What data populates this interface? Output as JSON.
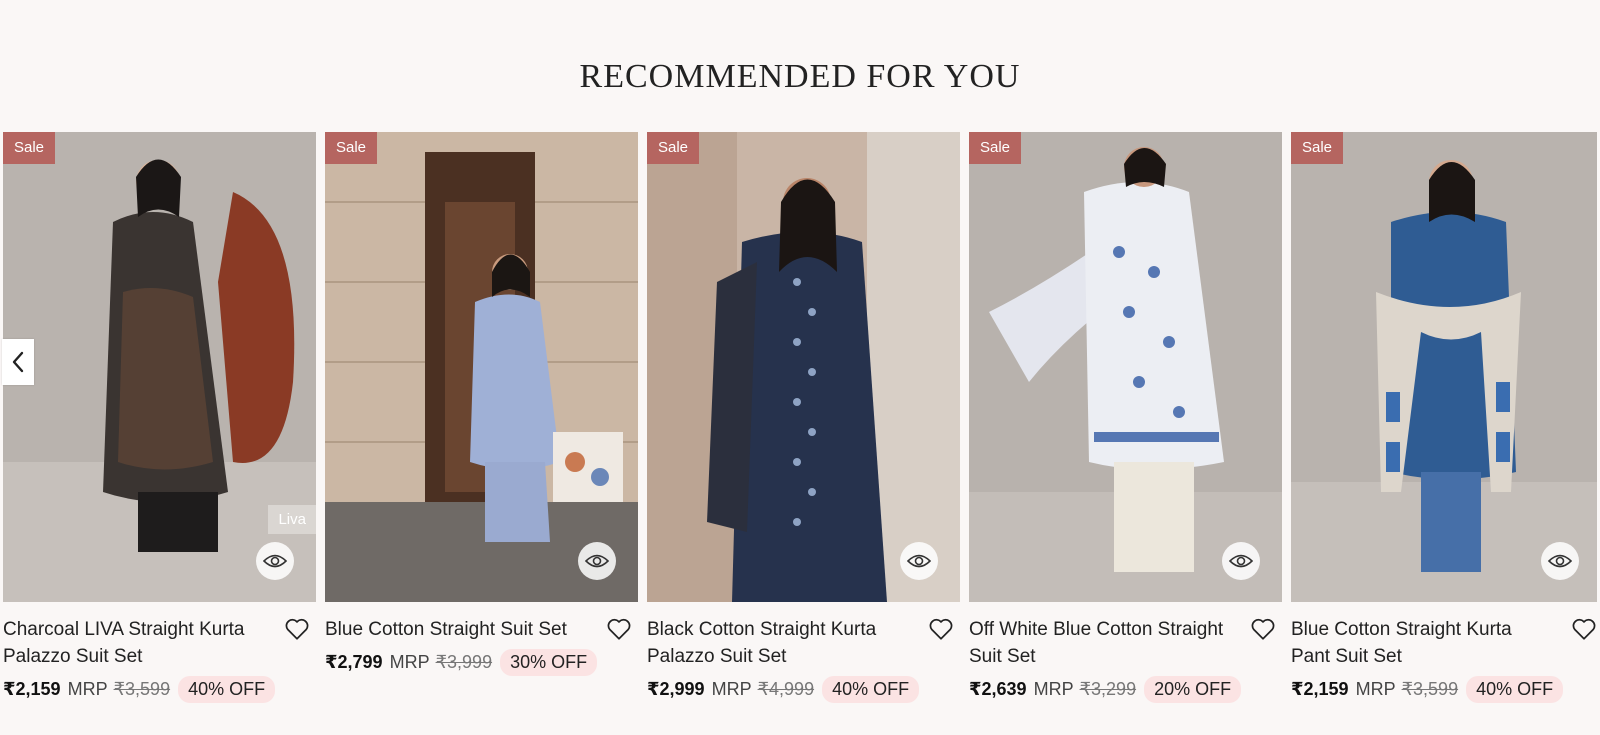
{
  "section": {
    "title": "RECOMMENDED FOR YOU"
  },
  "products": [
    {
      "sale_label": "Sale",
      "brand": "Liva",
      "name": "Charcoal LIVA Straight Kurta Palazzo Suit Set",
      "price": "₹2,159",
      "mrp_label": "MRP",
      "mrp": "₹3,599",
      "discount": "40% OFF"
    },
    {
      "sale_label": "Sale",
      "name": "Blue Cotton Straight Suit Set",
      "price": "₹2,799",
      "mrp_label": "MRP",
      "mrp": "₹3,999",
      "discount": "30% OFF"
    },
    {
      "sale_label": "Sale",
      "name": "Black Cotton Straight Kurta Palazzo Suit Set",
      "price": "₹2,999",
      "mrp_label": "MRP",
      "mrp": "₹4,999",
      "discount": "40% OFF"
    },
    {
      "sale_label": "Sale",
      "name": "Off White Blue Cotton Straight Suit Set",
      "price": "₹2,639",
      "mrp_label": "MRP",
      "mrp": "₹3,299",
      "discount": "20% OFF"
    },
    {
      "sale_label": "Sale",
      "name": "Blue Cotton Straight Kurta Pant Suit Set",
      "price": "₹2,159",
      "mrp_label": "MRP",
      "mrp": "₹3,599",
      "discount": "40% OFF"
    }
  ],
  "icons": {
    "prev": "chevron-left-icon",
    "wishlist": "heart-icon",
    "quick_view": "eye-icon"
  },
  "colors": {
    "sale_badge": "#b56560",
    "discount_pill": "#fbe3e3",
    "page_bg": "#faf7f6"
  }
}
